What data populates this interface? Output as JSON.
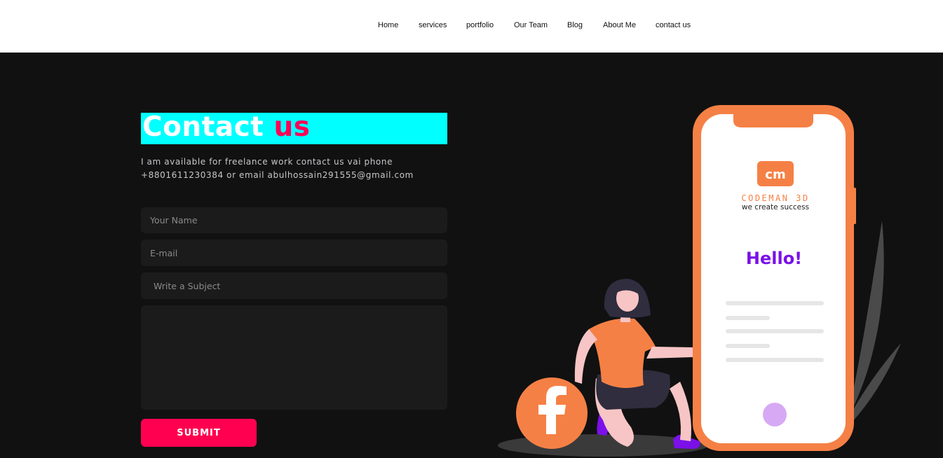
{
  "nav": {
    "items": [
      "Home",
      "services",
      "portfolio",
      "Our Team",
      "Blog",
      "About Me",
      "contact us"
    ]
  },
  "contact": {
    "title_main": "Contact",
    "title_accent": "us",
    "description": "I am available for freelance work contact us vai phone +8801611230384 or email abulhossain291555@gmail.com",
    "name_placeholder": "Your Name",
    "email_placeholder": "E-mail",
    "subject_placeholder": "Write a Subject",
    "message_value": "",
    "submit_label": "SUBMIT"
  },
  "illustration": {
    "brand_badge": "cm",
    "brand_name": "CODEMAN 3D",
    "tagline": "we create success",
    "greeting": "Hello!",
    "social_icon": "facebook-icon"
  },
  "colors": {
    "accent": "#ff0055",
    "title_highlight": "#00ffff",
    "phone_orange": "#f58045",
    "greeting_purple": "#7b10e8"
  }
}
